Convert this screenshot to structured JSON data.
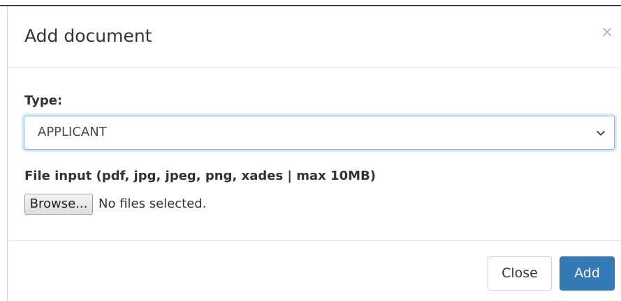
{
  "modal": {
    "title": "Add document",
    "close_glyph": "×",
    "type_label": "Type:",
    "type_select": {
      "selected": "APPLICANT",
      "icon": "chevron-down-icon"
    },
    "file_label": "File input (pdf, jpg, jpeg, png, xades | max 10MB)",
    "file_input": {
      "browse_label": "Browse...",
      "status": "No files selected."
    },
    "footer": {
      "close_label": "Close",
      "add_label": "Add"
    }
  },
  "colors": {
    "primary": "#337ab7",
    "focus_border": "#8db8e8",
    "muted_close": "#b5b5b5",
    "text": "#333333"
  }
}
